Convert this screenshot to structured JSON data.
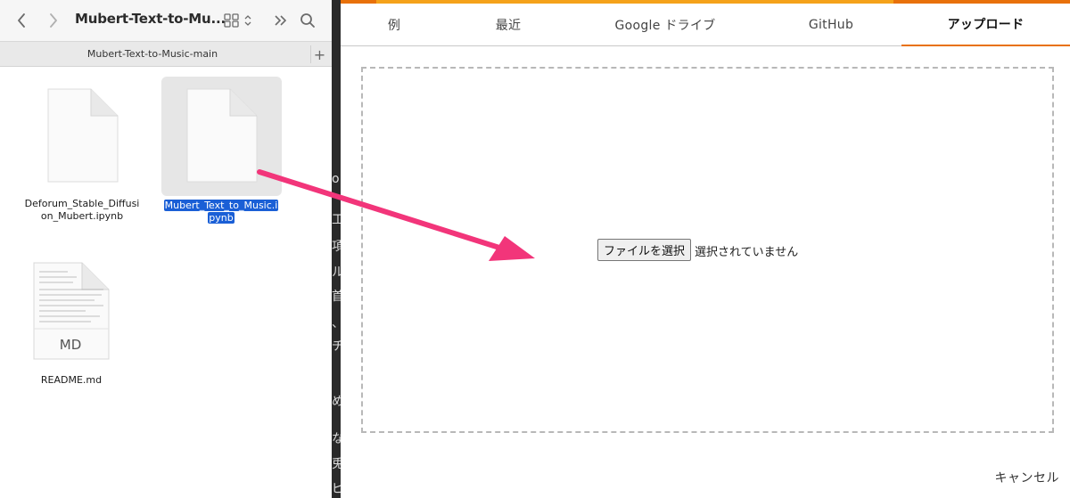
{
  "finder": {
    "window_title": "Mubert-Text-to-Mu...",
    "tab_label": "Mubert-Text-to-Music-main",
    "new_tab_symbol": "+",
    "files": [
      {
        "name_line1": "Deforum_Stable_Diffusi",
        "name_line2": "on_Mubert.ipynb",
        "selected": false,
        "type": "document-icon"
      },
      {
        "name_line1": "Mubert_Text_to_Music.i",
        "name_line2": "pynb",
        "selected": true,
        "type": "document-icon"
      },
      {
        "name_line1": "README.md",
        "name_line2": "",
        "selected": false,
        "type": "markdown-icon",
        "badge": "MD"
      }
    ]
  },
  "dialog": {
    "tabs": [
      {
        "label": "例",
        "active": false
      },
      {
        "label": "最近",
        "active": false
      },
      {
        "label": "Google ドライブ",
        "active": false
      },
      {
        "label": "GitHub",
        "active": false
      },
      {
        "label": "アップロード",
        "active": true
      }
    ],
    "file_button_label": "ファイルを選択",
    "no_file_text": "選択されていません",
    "cancel_label": "キャンセル"
  },
  "peek_chars": [
    "o",
    "工",
    "項",
    "ル",
    "首",
    "、",
    "チ",
    "め",
    "な",
    "兎",
    "ピ"
  ],
  "colors": {
    "accent_orange": "#e8710a",
    "accent_yellow": "#f5a21a",
    "selection_blue": "#1a5fd6",
    "arrow_pink": "#f2357a"
  }
}
